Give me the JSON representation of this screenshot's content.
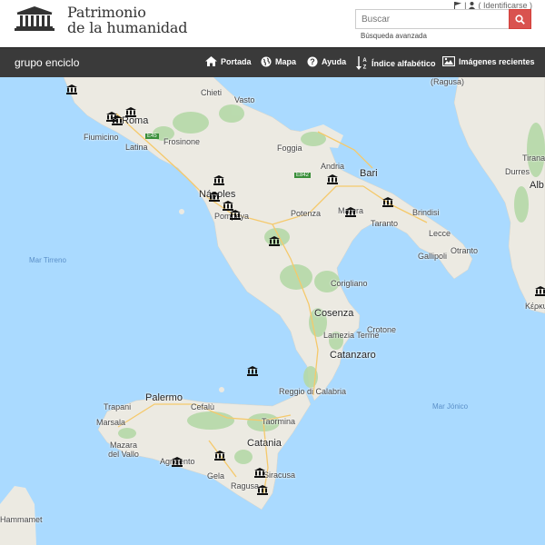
{
  "header": {
    "title_line1": "Patrimonio",
    "title_line2": "de la humanidad",
    "user_separator": "|",
    "login_label": "( Identificarse )",
    "search_placeholder": "Buscar",
    "advanced_search": "Búsqueda avanzada"
  },
  "nav": {
    "brand": "grupo enciclo",
    "items": [
      {
        "label": "Portada",
        "icon": "home-icon"
      },
      {
        "label": "Mapa",
        "icon": "globe-icon"
      },
      {
        "label": "Ayuda",
        "icon": "help-icon"
      },
      {
        "label": "Índice alfabético",
        "icon": "sort-az-icon"
      },
      {
        "label": "Imágenes recientes",
        "icon": "image-icon"
      }
    ]
  },
  "colors": {
    "water": "#aadaff",
    "land": "#eceae2",
    "accent": "#d9534f",
    "navbar": "#3a3a3a",
    "forest": "#b5d9a8"
  },
  "map": {
    "labels": {
      "roma": "Roma",
      "chieti": "Chieti",
      "vasto": "Vasto",
      "fiumicino": "Fiumicino",
      "latina": "Latina",
      "frosinone": "Frosinone",
      "foggia": "Foggia",
      "andria": "Andria",
      "bari": "Bari",
      "napoles": "Nápoles",
      "pompeya": "Pompeya",
      "potenza": "Potenza",
      "matera": "Matera",
      "taranto": "Taranto",
      "brindisi": "Brindisi",
      "lecce": "Lecce",
      "otranto": "Otranto",
      "gallipoli": "Gallipoli",
      "tirana": "Tirana",
      "durres": "Durres",
      "alb": "Alb",
      "mar_tirreno": "Mar Tirreno",
      "corigliano": "Corigliano",
      "cosenza": "Cosenza",
      "crotone": "Crotone",
      "catanzaro": "Catanzaro",
      "lamezia": "Lamezia Terme",
      "palermo": "Palermo",
      "trapani": "Trapani",
      "marsala": "Marsala",
      "cefalu": "Cefalù",
      "reggio": "Reggio di Calabria",
      "mar_jonico": "Mar Jónico",
      "catania": "Catania",
      "mazara": "Mazara del Vallo",
      "agrigento": "Agrigento",
      "gela": "Gela",
      "siracusa": "Siracusa",
      "ragusa": "Ragusa",
      "taormina": "Taormina",
      "kerkyra": "Κέρκυρα",
      "ragusa_top": "(Ragusa)",
      "hammamet": "Hammamet",
      "road_e45": "E45",
      "road_e842": "E842"
    }
  }
}
